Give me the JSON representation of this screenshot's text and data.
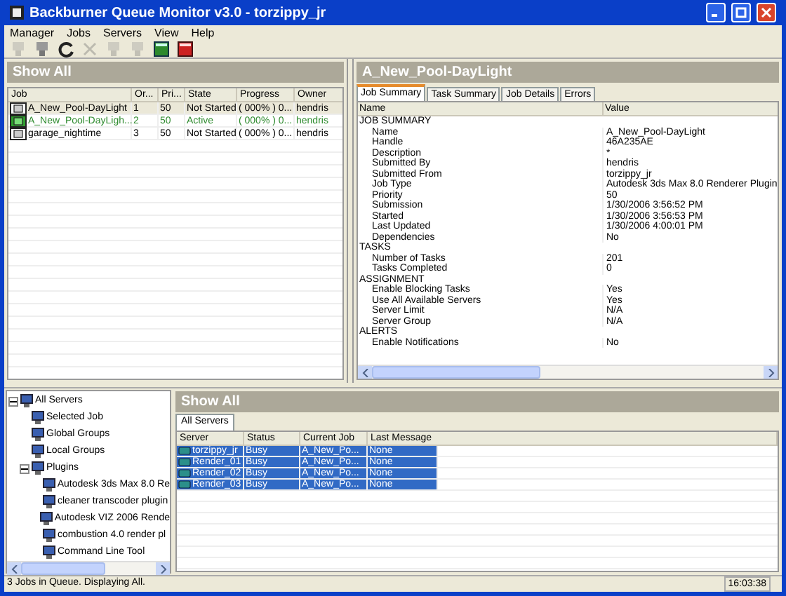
{
  "window": {
    "title": "Backburner Queue Monitor v3.0 - torzippy_jr"
  },
  "menu": [
    "Manager",
    "Jobs",
    "Servers",
    "View",
    "Help"
  ],
  "toolbar": [
    {
      "kind": "server",
      "disabled": true
    },
    {
      "kind": "server",
      "disabled": false
    },
    {
      "kind": "refresh",
      "disabled": false
    },
    {
      "kind": "delete",
      "disabled": true
    },
    {
      "kind": "server",
      "disabled": true
    },
    {
      "kind": "server",
      "disabled": true
    },
    {
      "kind": "green",
      "disabled": false
    },
    {
      "kind": "red",
      "disabled": false
    }
  ],
  "jobs_panel": {
    "header": "Show All",
    "columns": [
      "Job",
      "Or...",
      "Pri...",
      "State",
      "Progress",
      "Owner"
    ],
    "rows": [
      {
        "cells": [
          "A_New_Pool-DayLight",
          "1",
          "50",
          "Not Started",
          "( 000% ) 0...",
          "hendris"
        ],
        "selected": true,
        "active": false
      },
      {
        "cells": [
          "A_New_Pool-DayLigh...",
          "2",
          "50",
          "Active",
          "( 000% ) 0...",
          "hendris"
        ],
        "selected": false,
        "active": true
      },
      {
        "cells": [
          "garage_nightime",
          "3",
          "50",
          "Not Started",
          "( 000% ) 0...",
          "hendris"
        ],
        "selected": false,
        "active": false
      }
    ]
  },
  "details_panel": {
    "header": "A_New_Pool-DayLight",
    "tabs": [
      {
        "label": "Job Summary",
        "selected": true
      },
      {
        "label": "Task Summary",
        "selected": false
      },
      {
        "label": "Job Details",
        "selected": false
      },
      {
        "label": "Errors",
        "selected": false
      }
    ],
    "columns": [
      "Name",
      "Value"
    ],
    "sections": [
      {
        "title": "JOB SUMMARY",
        "rows": [
          [
            "Name",
            "A_New_Pool-DayLight"
          ],
          [
            "Handle",
            "46A235AE"
          ],
          [
            "Description",
            "*"
          ],
          [
            "Submitted By",
            "hendris"
          ],
          [
            "Submitted From",
            "torzippy_jr"
          ],
          [
            "Job Type",
            "Autodesk 3ds Max 8.0 Renderer Plugin"
          ],
          [
            "Priority",
            "50"
          ],
          [
            "Submission",
            "1/30/2006 3:56:52 PM"
          ],
          [
            "Started",
            "1/30/2006 3:56:53 PM"
          ],
          [
            "Last Updated",
            "1/30/2006 4:00:01 PM"
          ],
          [
            "Dependencies",
            "No"
          ]
        ]
      },
      {
        "title": "TASKS",
        "rows": [
          [
            "Number of Tasks",
            "201"
          ],
          [
            "Tasks Completed",
            "0"
          ]
        ]
      },
      {
        "title": "ASSIGNMENT",
        "rows": [
          [
            "Enable Blocking Tasks",
            "Yes"
          ],
          [
            "Use All Available Servers",
            "Yes"
          ],
          [
            "Server Limit",
            "N/A"
          ],
          [
            "Server Group",
            "N/A"
          ]
        ]
      },
      {
        "title": "ALERTS",
        "rows": [
          [
            "Enable Notifications",
            "No"
          ]
        ]
      }
    ]
  },
  "server_tree": [
    {
      "label": "All Servers",
      "expanded": true,
      "children": [
        {
          "label": "Selected Job"
        },
        {
          "label": "Global Groups"
        },
        {
          "label": "Local Groups"
        },
        {
          "label": "Plugins",
          "expanded": true,
          "children": [
            {
              "label": "Autodesk 3ds Max 8.0 Re"
            },
            {
              "label": "cleaner transcoder plugin"
            },
            {
              "label": "Autodesk VIZ 2006 Rende"
            },
            {
              "label": "combustion 4.0 render pl"
            },
            {
              "label": "Command Line Tool"
            }
          ]
        }
      ]
    }
  ],
  "servers_panel": {
    "header": "Show All",
    "tabs": [
      {
        "label": "All Servers",
        "selected": true
      }
    ],
    "columns": [
      "Server",
      "Status",
      "Current Job",
      "Last Message"
    ],
    "rows": [
      {
        "cells": [
          "torzippy_jr",
          "Busy",
          "A_New_Po...",
          "None"
        ],
        "selected": true
      },
      {
        "cells": [
          "Render_01",
          "Busy",
          "A_New_Po...",
          "None"
        ],
        "selected": true
      },
      {
        "cells": [
          "Render_02",
          "Busy",
          "A_New_Po...",
          "None"
        ],
        "selected": true
      },
      {
        "cells": [
          "Render_03",
          "Busy",
          "A_New_Po...",
          "None"
        ],
        "selected": true
      }
    ]
  },
  "status_bar": {
    "message": "3 Jobs in Queue. Displaying All.",
    "time": "16:03:38"
  }
}
